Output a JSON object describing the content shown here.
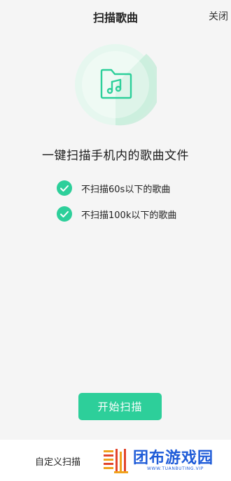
{
  "header": {
    "title": "扫描歌曲",
    "close_label": "关闭"
  },
  "hero": {
    "icon": "music-folder-scan-icon",
    "accent_color": "#2dcf9a",
    "light_color": "#e6f7ef"
  },
  "headline": "一键扫描手机内的歌曲文件",
  "features": [
    {
      "label": "不扫描60s以下的歌曲",
      "icon": "check-circle-icon"
    },
    {
      "label": "不扫描100k以下的歌曲",
      "icon": "check-circle-icon"
    }
  ],
  "scan_button": {
    "label": "开始扫描"
  },
  "bottom_bar": {
    "custom_scan_label": "自定义扫描"
  },
  "watermark": {
    "title": "团布游戏园",
    "url": "WWW.TUANBUTING.VIP",
    "color": "#1e5bd8"
  }
}
